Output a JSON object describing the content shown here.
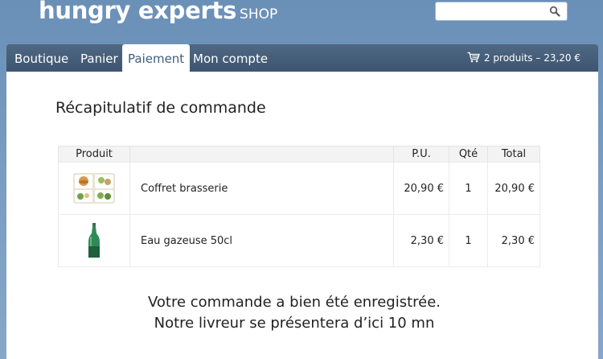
{
  "brand": {
    "name": "hungry experts",
    "sub": "SHOP"
  },
  "search": {
    "placeholder": ""
  },
  "nav": {
    "tabs": [
      {
        "label": "Boutique"
      },
      {
        "label": "Panier"
      },
      {
        "label": "Paiement",
        "active": true
      },
      {
        "label": "Mon compte"
      }
    ],
    "cart": {
      "icon": "cart-icon",
      "label": "2 produits – 23,20 €"
    }
  },
  "main": {
    "title": "Récapitulatif de commande",
    "table": {
      "headers": {
        "product": "Produit",
        "unit_price": "P.U.",
        "qty": "Qté",
        "total": "Total"
      },
      "rows": [
        {
          "image": "food-tray-image",
          "name": "Coffret brasserie",
          "unit_price": "20,90 €",
          "qty": "1",
          "total": "20,90 €"
        },
        {
          "image": "water-bottle-image",
          "name": "Eau gazeuse 50cl",
          "unit_price": "2,30 €",
          "qty": "1",
          "total": "2,30 €"
        }
      ]
    },
    "message": {
      "line1": "Votre commande a bien été enregistrée.",
      "line2": "Notre livreur se présentera d’ici 10 mn"
    }
  },
  "colors": {
    "background": "#7d9fc3",
    "navbar": "#445c77",
    "active_tab_text": "#3d5d80"
  }
}
